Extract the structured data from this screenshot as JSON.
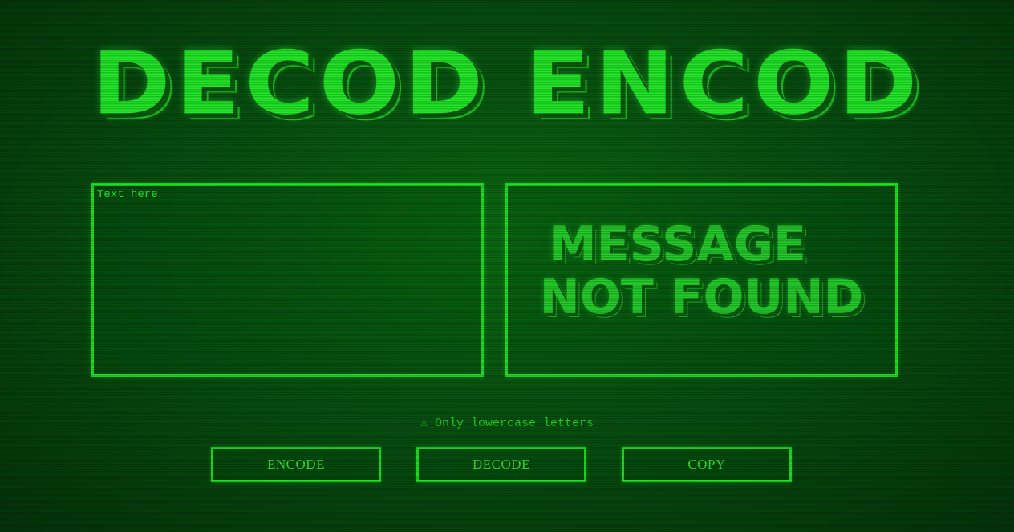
{
  "app": {
    "title": "DECOD ENCOD"
  },
  "input": {
    "placeholder": "Text here",
    "value": ""
  },
  "output": {
    "message_line1": "MESSAGE",
    "message_line2": "NOT FOUND"
  },
  "warning": {
    "icon": "warning-icon",
    "glyph": "⚠",
    "text": "Only lowercase letters"
  },
  "buttons": {
    "encode_label": "ENCODE",
    "decode_label": "DECODE",
    "copy_label": "COPY"
  },
  "colors": {
    "accent": "#1fe025",
    "background": "#075010"
  }
}
